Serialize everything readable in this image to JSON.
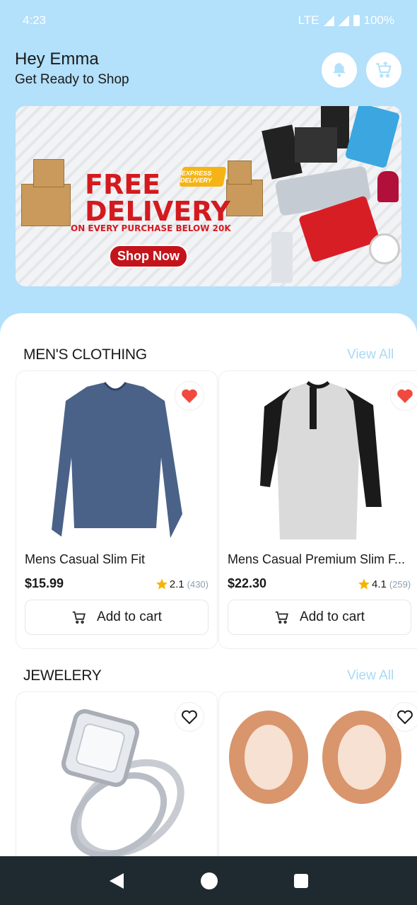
{
  "status": {
    "time": "4:23",
    "network": "LTE",
    "battery": "100%"
  },
  "header": {
    "greeting": "Hey Emma",
    "subtitle": "Get Ready to Shop"
  },
  "banner": {
    "line1": "FREE",
    "line2": "DELIVERY",
    "tagline": "ON EVERY PURCHASE BELOW 20K",
    "button": "Shop Now",
    "badge": "EXPRESS DELIVERY"
  },
  "sections": [
    {
      "title": "MEN'S CLOTHING",
      "view_all": "View All",
      "products": [
        {
          "name": "Mens Casual Slim Fit",
          "price": "$15.99",
          "rating": "2.1",
          "count": "(430)",
          "add_label": "Add to cart",
          "favorited": true
        },
        {
          "name": "Mens Casual Premium Slim F...",
          "price": "$22.30",
          "rating": "4.1",
          "count": "(259)",
          "add_label": "Add to cart",
          "favorited": true
        }
      ]
    },
    {
      "title": "JEWELERY",
      "view_all": "View All",
      "products": [
        {
          "favorited": false
        },
        {
          "favorited": false
        }
      ]
    }
  ],
  "colors": {
    "accent": "#b3e0fb",
    "heart": "#f04a3e",
    "star": "#f5b400",
    "view_all": "#a9d9f5"
  }
}
